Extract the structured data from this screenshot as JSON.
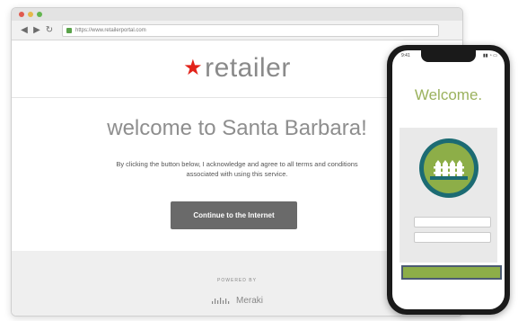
{
  "browser": {
    "url": "https://www.retailerportal.com",
    "nav": {
      "back": "◀",
      "forward": "▶",
      "reload": "↻"
    },
    "traffic_lights": [
      "#e05a4e",
      "#e6b84a",
      "#62b54f"
    ]
  },
  "page": {
    "logo": {
      "star": "★",
      "text": "retailer"
    },
    "welcome": "welcome to Santa Barbara!",
    "terms": "By clicking the button below, I acknowledge and agree to all terms and conditions associated with using this service.",
    "cta_label": "Continue to the Internet",
    "footer": {
      "powered_by": "POWERED BY",
      "brand": "Meraki",
      "brand_icon": "cisco-logo-icon"
    }
  },
  "phone": {
    "status": {
      "time": "9:41",
      "icons": "▮▮ ◔ ▭"
    },
    "welcome": "Welcome.",
    "badge_icon": "fence-badge-icon",
    "fields": [
      "",
      ""
    ]
  },
  "colors": {
    "accent_red": "#e2231a",
    "cta_gray": "#6a6a6a",
    "phone_green": "#8dae48",
    "badge_teal": "#1c6b73"
  }
}
